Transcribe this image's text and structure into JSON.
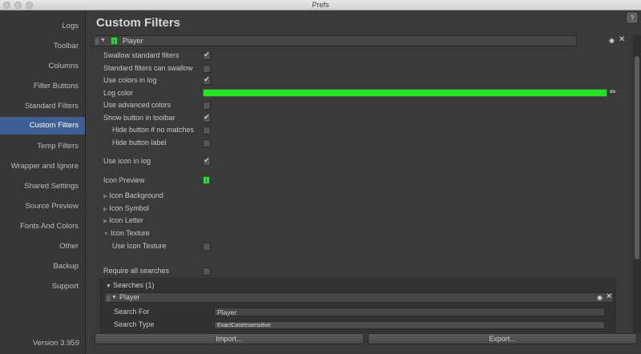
{
  "window": {
    "title": "Prefs"
  },
  "sidebar": {
    "items": [
      {
        "label": "Logs"
      },
      {
        "label": "Toolbar"
      },
      {
        "label": "Columns"
      },
      {
        "label": "Filter Buttons"
      },
      {
        "label": "Standard Filters"
      },
      {
        "label": "Custom Filters",
        "active": true
      },
      {
        "label": "Temp Filters"
      },
      {
        "label": "Wrapper and Ignore"
      },
      {
        "label": "Shared Settings"
      },
      {
        "label": "Source Preview"
      },
      {
        "label": "Fonts And Colors"
      },
      {
        "label": "Other"
      },
      {
        "label": "Backup"
      },
      {
        "label": "Support"
      }
    ],
    "version": "Version 3.959"
  },
  "main": {
    "title": "Custom Filters",
    "help_label": "?",
    "filter": {
      "grip": "||",
      "name": "Player",
      "options": [
        {
          "label": "Swallow standard filters",
          "checked": true
        },
        {
          "label": "Standard filters can swallow",
          "checked": false
        },
        {
          "label": "Use colors in log",
          "checked": true
        },
        {
          "label": "Log color",
          "color": "#20e61e"
        },
        {
          "label": "Use advanced colors",
          "checked": false
        },
        {
          "label": "Show button in toolbar",
          "checked": true
        },
        {
          "label": "Hide button if no matches",
          "checked": false
        },
        {
          "label": "Hide button label",
          "checked": false
        },
        {
          "label": "Use icon in log",
          "checked": true
        },
        {
          "label": "Icon Preview"
        }
      ],
      "foldouts": [
        {
          "label": "Icon Background"
        },
        {
          "label": "Icon Symbol"
        },
        {
          "label": "Icon Letter"
        },
        {
          "label": "Icon Texture",
          "expanded": true
        }
      ],
      "use_icon_texture": {
        "label": "Use Icon Texture",
        "checked": false
      },
      "require_all": {
        "label": "Require all searches",
        "checked": false
      },
      "searches": {
        "label": "Searches (1)",
        "item": {
          "name": "Player",
          "search_for_label": "Search For",
          "search_for_value": "Player",
          "search_type_label": "Search Type",
          "search_type_value": "ExactCaseInsensitive"
        }
      }
    },
    "buttons": {
      "import": "Import...",
      "export": "Export..."
    }
  },
  "colors": {
    "accent": "#3e5f96",
    "log_color": "#20e61e"
  }
}
